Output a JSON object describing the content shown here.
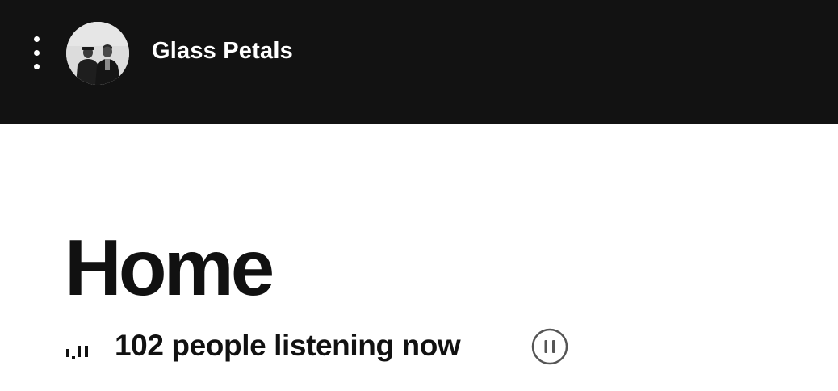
{
  "header": {
    "artist_name": "Glass Petals",
    "menu_icon": "more-vertical-icon",
    "avatar": "artist-photo"
  },
  "main": {
    "title": "Home",
    "listeners_text": "102 people listening now",
    "equalizer_icon": "equalizer-icon",
    "pause_icon": "pause-circle-icon"
  },
  "colors": {
    "header_bg": "#121212",
    "page_bg": "#ffffff",
    "text_dark": "#111111",
    "text_light": "#ffffff",
    "icon_gray": "#555555"
  }
}
